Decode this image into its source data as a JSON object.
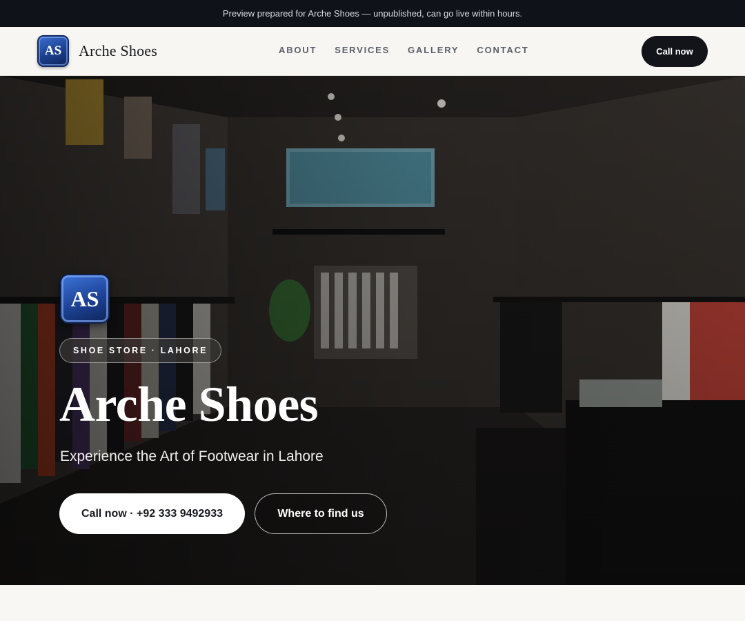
{
  "preview_banner": {
    "text": "Preview prepared for Arche Shoes — unpublished, can go live within hours."
  },
  "header": {
    "logo_initials": "AS",
    "brand_name": "Arche Shoes",
    "nav": [
      {
        "label": "ABOUT"
      },
      {
        "label": "SERVICES"
      },
      {
        "label": "GALLERY"
      },
      {
        "label": "CONTACT"
      }
    ],
    "cta_label": "Call now"
  },
  "hero": {
    "logo_initials": "AS",
    "tag": "SHOE STORE · LAHORE",
    "title": "Arche Shoes",
    "subtitle": "Experience the Art of Footwear in Lahore",
    "primary_button": "Call now · +92 333 9492933",
    "secondary_button": "Where to find us",
    "image_description_icon": "store-interior-photo"
  },
  "colors": {
    "dark": "#12141a",
    "accent_blue": "#1d4296",
    "page_bg": "#f8f7f4"
  }
}
